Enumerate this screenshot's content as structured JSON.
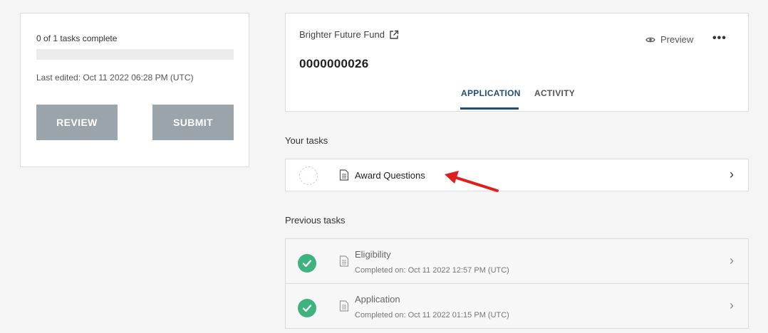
{
  "progress": {
    "label": "0 of 1 tasks complete",
    "completed": 0,
    "total": 1,
    "fraction": 0,
    "last_edited": "Last edited: Oct 11 2022 06:28 PM (UTC)"
  },
  "actions": {
    "review_label": "REVIEW",
    "submit_label": "SUBMIT"
  },
  "application": {
    "fund_name": "Brighter Future Fund",
    "id": "0000000026",
    "preview_label": "Preview",
    "more_label": "•••",
    "tabs": [
      {
        "label": "APPLICATION",
        "active": true
      },
      {
        "label": "ACTIVITY",
        "active": false
      }
    ]
  },
  "your_tasks": {
    "heading": "Your tasks",
    "items": [
      {
        "title": "Award Questions",
        "status": "incomplete"
      }
    ]
  },
  "previous_tasks": {
    "heading": "Previous tasks",
    "items": [
      {
        "title": "Eligibility",
        "completed": "Completed on: Oct 11 2022 12:57 PM (UTC)",
        "status": "complete"
      },
      {
        "title": "Application",
        "completed": "Completed on: Oct 11 2022 01:15 PM (UTC)",
        "status": "complete"
      }
    ]
  },
  "colors": {
    "accent": "#1f4e79",
    "button": "#9aa4aa",
    "success": "#3fb37f",
    "annotation_arrow": "#e01e1e"
  },
  "icons": {
    "external_link": "external-link-icon",
    "preview": "eye-icon",
    "document": "document-icon",
    "chevron": "chevron-right-icon",
    "check": "check-circle-icon"
  }
}
